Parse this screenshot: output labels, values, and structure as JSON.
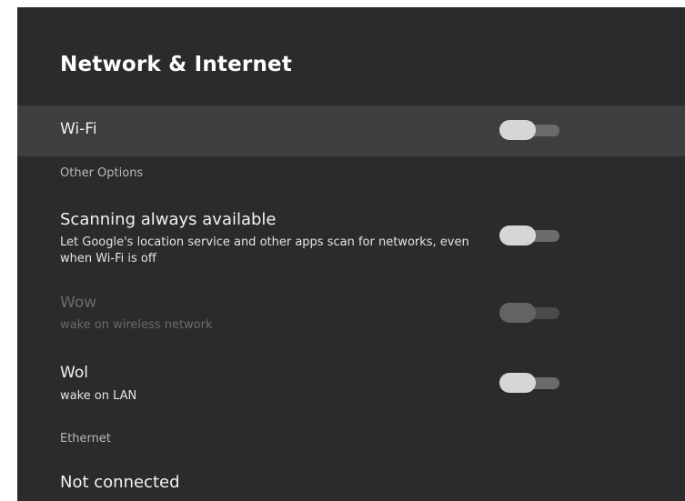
{
  "page": {
    "title": "Network & Internet"
  },
  "wifi": {
    "label": "Wi-Fi",
    "enabled": false
  },
  "sections": {
    "other_options": "Other Options",
    "ethernet": "Ethernet"
  },
  "scanning": {
    "label": "Scanning always available",
    "description": "Let Google's location service and other apps scan for networks, even when Wi-Fi is off",
    "enabled": false
  },
  "wow": {
    "label": "Wow",
    "description": "wake on wireless network",
    "enabled": false,
    "disabled": true
  },
  "wol": {
    "label": "Wol",
    "description": "wake on LAN",
    "enabled": false
  },
  "ethernet": {
    "status": "Not connected"
  },
  "colors": {
    "background": "#2b2b2b",
    "selected_row": "#3e3e3e",
    "toggle_thumb": "#d6d6d6",
    "toggle_track": "#6b6b6b"
  }
}
